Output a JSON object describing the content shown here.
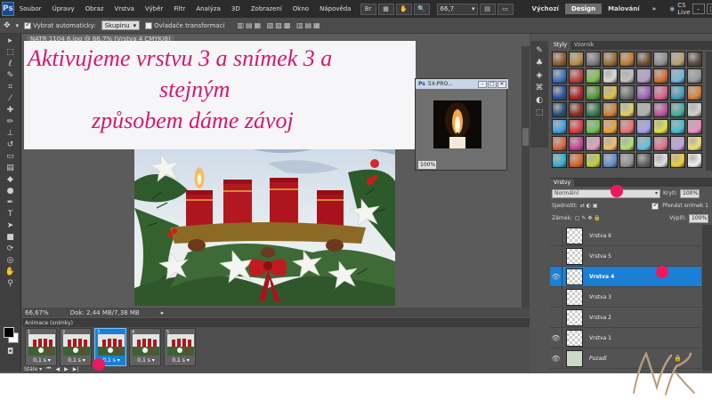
{
  "menubar": {
    "logo": "Ps",
    "items": [
      "Soubor",
      "Úpravy",
      "Obraz",
      "Vrstva",
      "Výběr",
      "Filtr",
      "Analýza",
      "3D",
      "Zobrazení",
      "Okno",
      "Nápověda"
    ],
    "zoom": "66,7",
    "workspaces": [
      "Výchozí",
      "Design",
      "Malování"
    ],
    "active_workspace": "Design",
    "cs_live": "CS Live"
  },
  "options": {
    "auto_select_label": "Vybrat automaticky:",
    "auto_select_value": "Skupinu",
    "transform_label": "Ovladače transformací"
  },
  "document": {
    "tab_title": "NATR 1104 6.jpg @ 66.7% (Vrstva 4 CMYK/8)",
    "zoom": "66,67%",
    "doc_info": "Dok: 2,44 MB/7,38 MB"
  },
  "overlay": {
    "lines": [
      "Aktivujeme vrstvu 3 a snímek 3 a",
      "stejným",
      "způsobem dáme závoj"
    ]
  },
  "preview": {
    "title": "5X-PRO...",
    "zoom": "100%"
  },
  "animation": {
    "title": "Animace (snímky)",
    "frames": [
      {
        "num": "1",
        "delay": "0,1 s"
      },
      {
        "num": "2",
        "delay": "0,1 s"
      },
      {
        "num": "3",
        "delay": "0,1 s"
      },
      {
        "num": "4",
        "delay": "0,1 s"
      },
      {
        "num": "5",
        "delay": "0,1 s"
      }
    ],
    "active_frame": 3,
    "loop": "Stále"
  },
  "styles_panel": {
    "tabs": [
      "Styly",
      "Vzorník"
    ],
    "swatches": [
      "#8c5a2a",
      "#b58d3d",
      "#7a7a7a",
      "#a06a30",
      "#c47b2c",
      "#6f4e2c",
      "#8f8f8f",
      "#b7a26a",
      "#594a3a",
      "#3a6fbf",
      "#c23b3b",
      "#7dbf4a",
      "#d9d9d9",
      "#c0c0c0",
      "#b3a0d0",
      "#d96c2f",
      "#6fb7e0",
      "#9a9a9a",
      "#2a4f9e",
      "#b52020",
      "#4f9e2f",
      "#e0c040",
      "#707070",
      "#a05fc0",
      "#e05f8f",
      "#3fa0c0",
      "#e07f30",
      "#234a7a",
      "#8f2a1a",
      "#2f7a4a",
      "#d08030",
      "#e0d060",
      "#b0b0b0",
      "#c050a0",
      "#40b0a0",
      "#d0d0d0",
      "#3aa0e0",
      "#e03a3a",
      "#70c050",
      "#f0a030",
      "#f07070",
      "#a0a0f0",
      "#e0e040",
      "#40c0d0",
      "#f090c0",
      "#e06040",
      "#d04090",
      "#e0a0c0",
      "#f0c060",
      "#b0e070",
      "#60c0e0",
      "#e07090",
      "#c0a0e0",
      "#f0e070",
      "#30b0d0",
      "#e06020",
      "#c0d030",
      "#6090d0",
      "#909090",
      "#606060",
      "#e0e0e0",
      "#f0d030",
      "#f0f0f0"
    ],
    "icons": [
      "brush-icon",
      "stamp-icon",
      "layers-icon",
      "transform-icon"
    ]
  },
  "layers_panel": {
    "tab": "Vrstvy",
    "blend_mode": "Normální",
    "opacity_label": "Krytí:",
    "opacity": "100%",
    "unify_label": "Sjednotit:",
    "propagate_label": "Přenést snímek 1",
    "lock_label": "Zámek:",
    "fill_label": "Výplň:",
    "fill": "100%",
    "layers": [
      {
        "name": "Vrstva 6",
        "visible": false,
        "active": false
      },
      {
        "name": "Vrstva 5",
        "visible": false,
        "active": false
      },
      {
        "name": "Vrstva 4",
        "visible": true,
        "active": true
      },
      {
        "name": "Vrstva 3",
        "visible": false,
        "active": false
      },
      {
        "name": "Vrstva 2",
        "visible": false,
        "active": false
      },
      {
        "name": "Vrstva 1",
        "visible": true,
        "active": false
      },
      {
        "name": "Pozadí",
        "visible": true,
        "active": false
      }
    ]
  },
  "colors": {
    "accent": "#1b7fd5",
    "marker": "#f0185c",
    "overlay_text": "#d6186a"
  }
}
